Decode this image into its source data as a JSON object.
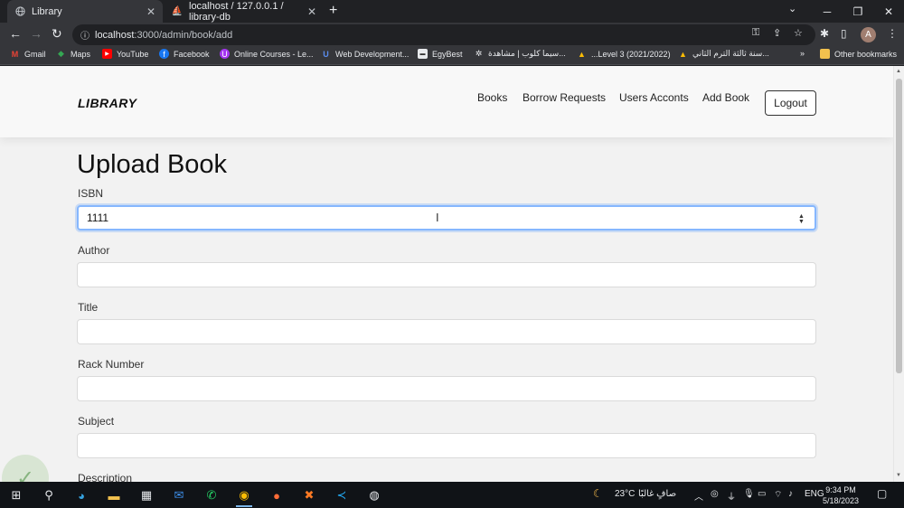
{
  "browser": {
    "tabs": [
      {
        "title": "Library",
        "active": true
      },
      {
        "title": "localhost / 127.0.0.1 / library-db",
        "active": false
      }
    ],
    "url_host": "localhost",
    "url_path": ":3000/admin/book/add",
    "bookmarks": [
      {
        "label": "Gmail",
        "icon": "gmail-icon"
      },
      {
        "label": "Maps",
        "icon": "maps-icon"
      },
      {
        "label": "YouTube",
        "icon": "youtube-icon"
      },
      {
        "label": "Facebook",
        "icon": "facebook-icon"
      },
      {
        "label": "Online Courses - Le...",
        "icon": "udemy-icon"
      },
      {
        "label": "Web Development...",
        "icon": "udemy-icon"
      },
      {
        "label": "EgyBest",
        "icon": "egybest-icon"
      },
      {
        "label": "سيما كلوب | مشاهدة...",
        "icon": "cinema-icon"
      },
      {
        "label": "...Level 3 (2021/2022)",
        "icon": "drive-icon"
      },
      {
        "label": "سنة ثالثة الترم الثاني...",
        "icon": "drive-icon"
      }
    ],
    "other_bookmarks": "Other bookmarks",
    "avatar_letter": "A"
  },
  "app": {
    "brand": "LIBRARY",
    "nav": [
      "Books",
      "Borrow Requests",
      "Users Acconts",
      "Add Book"
    ],
    "logout": "Logout"
  },
  "form": {
    "title": "Upload Book",
    "fields": [
      {
        "label": "ISBN",
        "value": "1111"
      },
      {
        "label": "Author",
        "value": ""
      },
      {
        "label": "Title",
        "value": ""
      },
      {
        "label": "Rack Number",
        "value": ""
      },
      {
        "label": "Subject",
        "value": ""
      },
      {
        "label": "Description",
        "value": ""
      }
    ]
  },
  "taskbar": {
    "weather": "23°C",
    "weather_text": "صافٍ غالبًا",
    "lang": "ENG",
    "time": "9:34 PM",
    "date": "5/18/2023"
  },
  "colors": {
    "focus_ring": "#86b7fe",
    "page_bg": "#f2f2f2",
    "navbar_bg": "#f8f8f8"
  }
}
